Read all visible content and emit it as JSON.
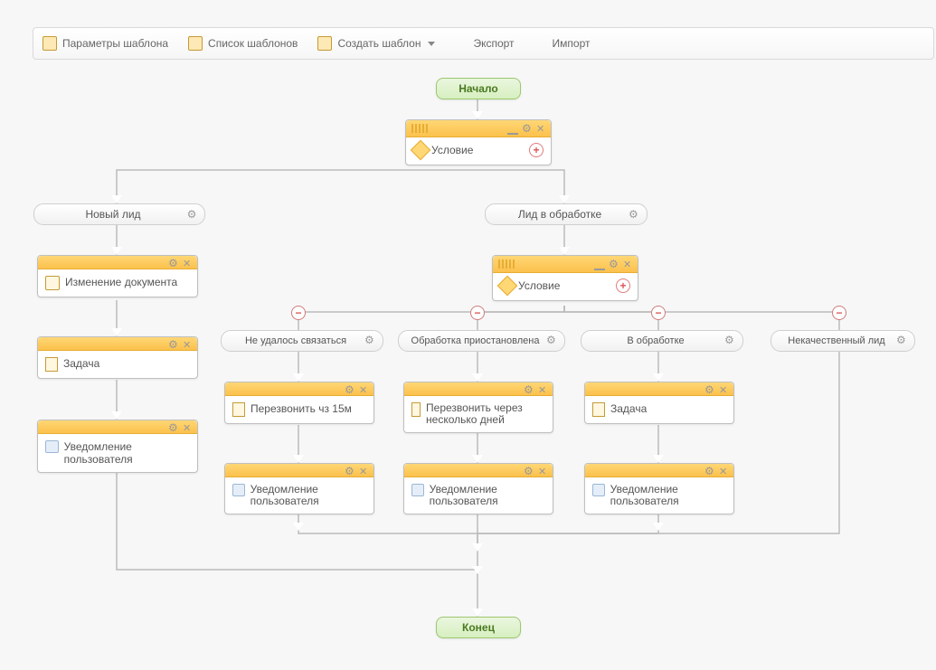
{
  "toolbar": {
    "params": "Параметры шаблона",
    "list": "Список шаблонов",
    "create": "Создать шаблон",
    "export": "Экспорт",
    "import": "Импорт"
  },
  "nodes": {
    "start": "Начало",
    "end": "Конец",
    "condition": "Условие",
    "branch_new_lead": "Новый лид",
    "branch_in_progress": "Лид в обработке",
    "branch_no_contact": "Не удалось связаться",
    "branch_paused": "Обработка приостановлена",
    "branch_processing": "В обработке",
    "branch_low_quality": "Некачественный лид",
    "act_change_doc": "Изменение документа",
    "act_task": "Задача",
    "act_notify": "Уведомление пользователя",
    "act_callback_15": "Перезвонить чз 15м",
    "act_callback_days": "Перезвонить через несколько дней"
  }
}
